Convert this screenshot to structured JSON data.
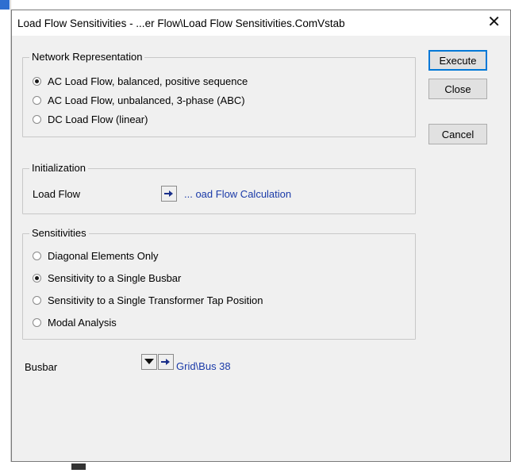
{
  "dialog": {
    "title": "Load Flow Sensitivities - ...er Flow\\Load Flow Sensitivities.ComVstab",
    "close_glyph": "✕"
  },
  "buttons": {
    "execute": "Execute",
    "close": "Close",
    "cancel": "Cancel"
  },
  "network": {
    "title": "Network Representation",
    "options": [
      {
        "label": "AC Load Flow, balanced, positive sequence",
        "checked": true
      },
      {
        "label": "AC Load Flow, unbalanced, 3-phase (ABC)",
        "checked": false
      },
      {
        "label": "DC Load Flow (linear)",
        "checked": false
      }
    ]
  },
  "initialization": {
    "title": "Initialization",
    "load_flow_label": "Load Flow",
    "load_flow_link": "... oad Flow Calculation"
  },
  "sensitivities": {
    "title": "Sensitivities",
    "options": [
      {
        "label": "Diagonal Elements Only",
        "checked": false
      },
      {
        "label": "Sensitivity to a Single Busbar",
        "checked": true
      },
      {
        "label": "Sensitivity to a Single Transformer Tap Position",
        "checked": false
      },
      {
        "label": "Modal Analysis",
        "checked": false
      }
    ]
  },
  "busbar": {
    "label": "Busbar",
    "link": "Grid\\Bus 38"
  },
  "icons": {
    "select_arrow": "arrow-right-icon",
    "dropdown": "triangle-down-icon",
    "close": "close-icon"
  }
}
